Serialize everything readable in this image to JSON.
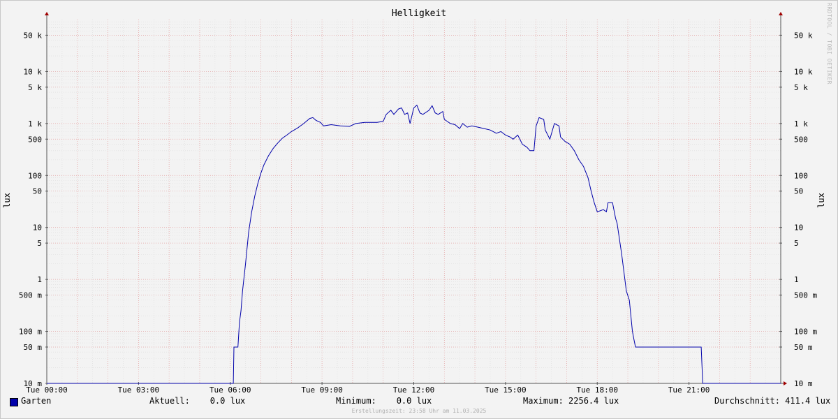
{
  "chart_data": {
    "type": "line",
    "title": "Helligkeit",
    "ylabel": "lux",
    "yscale": "log",
    "ylim": [
      0.01,
      100000
    ],
    "y_ticks": [
      {
        "value": 0.01,
        "label": "10 m"
      },
      {
        "value": 0.05,
        "label": "50 m"
      },
      {
        "value": 0.1,
        "label": "100 m"
      },
      {
        "value": 0.5,
        "label": "500 m"
      },
      {
        "value": 1,
        "label": "1"
      },
      {
        "value": 5,
        "label": "5"
      },
      {
        "value": 10,
        "label": "10"
      },
      {
        "value": 50,
        "label": "50"
      },
      {
        "value": 100,
        "label": "100"
      },
      {
        "value": 500,
        "label": "500"
      },
      {
        "value": 1000,
        "label": "1 k"
      },
      {
        "value": 5000,
        "label": "5 k"
      },
      {
        "value": 10000,
        "label": "10 k"
      },
      {
        "value": 50000,
        "label": "50 k"
      }
    ],
    "xlim": [
      0,
      24
    ],
    "x_ticks": [
      {
        "value": 0,
        "label": "Tue 00:00"
      },
      {
        "value": 3,
        "label": "Tue 03:00"
      },
      {
        "value": 6,
        "label": "Tue 06:00"
      },
      {
        "value": 9,
        "label": "Tue 09:00"
      },
      {
        "value": 12,
        "label": "Tue 12:00"
      },
      {
        "value": 15,
        "label": "Tue 15:00"
      },
      {
        "value": 18,
        "label": "Tue 18:00"
      },
      {
        "value": 21,
        "label": "Tue 21:00"
      }
    ],
    "grid": true,
    "series": [
      {
        "name": "Garten",
        "color": "#0000aa",
        "x_unit": "hours",
        "points": [
          [
            0,
            0.01
          ],
          [
            6.1,
            0.01
          ],
          [
            6.12,
            0.05
          ],
          [
            6.25,
            0.05
          ],
          [
            6.3,
            0.15
          ],
          [
            6.35,
            0.25
          ],
          [
            6.4,
            0.6
          ],
          [
            6.5,
            2
          ],
          [
            6.6,
            8
          ],
          [
            6.7,
            20
          ],
          [
            6.8,
            40
          ],
          [
            6.9,
            70
          ],
          [
            7.0,
            110
          ],
          [
            7.1,
            160
          ],
          [
            7.25,
            240
          ],
          [
            7.4,
            330
          ],
          [
            7.55,
            420
          ],
          [
            7.7,
            520
          ],
          [
            7.85,
            600
          ],
          [
            8.0,
            700
          ],
          [
            8.2,
            820
          ],
          [
            8.4,
            1000
          ],
          [
            8.6,
            1250
          ],
          [
            8.7,
            1300
          ],
          [
            8.8,
            1150
          ],
          [
            8.95,
            1050
          ],
          [
            9.05,
            900
          ],
          [
            9.3,
            950
          ],
          [
            9.6,
            900
          ],
          [
            9.9,
            880
          ],
          [
            10.1,
            1000
          ],
          [
            10.4,
            1050
          ],
          [
            10.8,
            1050
          ],
          [
            11.0,
            1100
          ],
          [
            11.1,
            1500
          ],
          [
            11.25,
            1800
          ],
          [
            11.35,
            1500
          ],
          [
            11.5,
            1900
          ],
          [
            11.6,
            2000
          ],
          [
            11.7,
            1500
          ],
          [
            11.8,
            1600
          ],
          [
            11.88,
            1000
          ],
          [
            12.0,
            2000
          ],
          [
            12.1,
            2256.4
          ],
          [
            12.2,
            1600
          ],
          [
            12.3,
            1500
          ],
          [
            12.5,
            1800
          ],
          [
            12.6,
            2200
          ],
          [
            12.7,
            1600
          ],
          [
            12.8,
            1500
          ],
          [
            12.95,
            1700
          ],
          [
            13.0,
            1200
          ],
          [
            13.2,
            1000
          ],
          [
            13.35,
            950
          ],
          [
            13.5,
            800
          ],
          [
            13.6,
            1000
          ],
          [
            13.75,
            850
          ],
          [
            13.9,
            900
          ],
          [
            14.1,
            850
          ],
          [
            14.3,
            800
          ],
          [
            14.5,
            750
          ],
          [
            14.7,
            650
          ],
          [
            14.85,
            700
          ],
          [
            15.0,
            600
          ],
          [
            15.15,
            550
          ],
          [
            15.25,
            500
          ],
          [
            15.4,
            600
          ],
          [
            15.55,
            400
          ],
          [
            15.7,
            350
          ],
          [
            15.8,
            300
          ],
          [
            15.93,
            300
          ],
          [
            16.0,
            900
          ],
          [
            16.1,
            1300
          ],
          [
            16.25,
            1200
          ],
          [
            16.3,
            750
          ],
          [
            16.45,
            500
          ],
          [
            16.6,
            1000
          ],
          [
            16.75,
            900
          ],
          [
            16.8,
            550
          ],
          [
            16.95,
            450
          ],
          [
            17.1,
            400
          ],
          [
            17.25,
            300
          ],
          [
            17.4,
            200
          ],
          [
            17.55,
            150
          ],
          [
            17.7,
            90
          ],
          [
            17.8,
            50
          ],
          [
            17.9,
            30
          ],
          [
            18.0,
            20
          ],
          [
            18.2,
            22
          ],
          [
            18.3,
            20
          ],
          [
            18.35,
            30
          ],
          [
            18.5,
            30
          ],
          [
            18.6,
            15
          ],
          [
            18.65,
            12
          ],
          [
            18.8,
            3
          ],
          [
            18.95,
            0.6
          ],
          [
            19.05,
            0.4
          ],
          [
            19.15,
            0.1
          ],
          [
            19.2,
            0.07
          ],
          [
            19.25,
            0.05
          ],
          [
            21.4,
            0.05
          ],
          [
            21.45,
            0.01
          ],
          [
            24,
            0.01
          ]
        ]
      }
    ]
  },
  "legend": {
    "series_name": "Garten",
    "current": "Aktuell:    0.0 lux",
    "minimum": "Minimum:    0.0 lux",
    "maximum": "Maximum: 2256.4 lux",
    "average": "Durchschnitt: 411.4 lux"
  },
  "footer": "Erstellungszeit: 23:58 Uhr am 11.03.2025",
  "watermark": "RRDTOOL / TOBI OETIKER"
}
